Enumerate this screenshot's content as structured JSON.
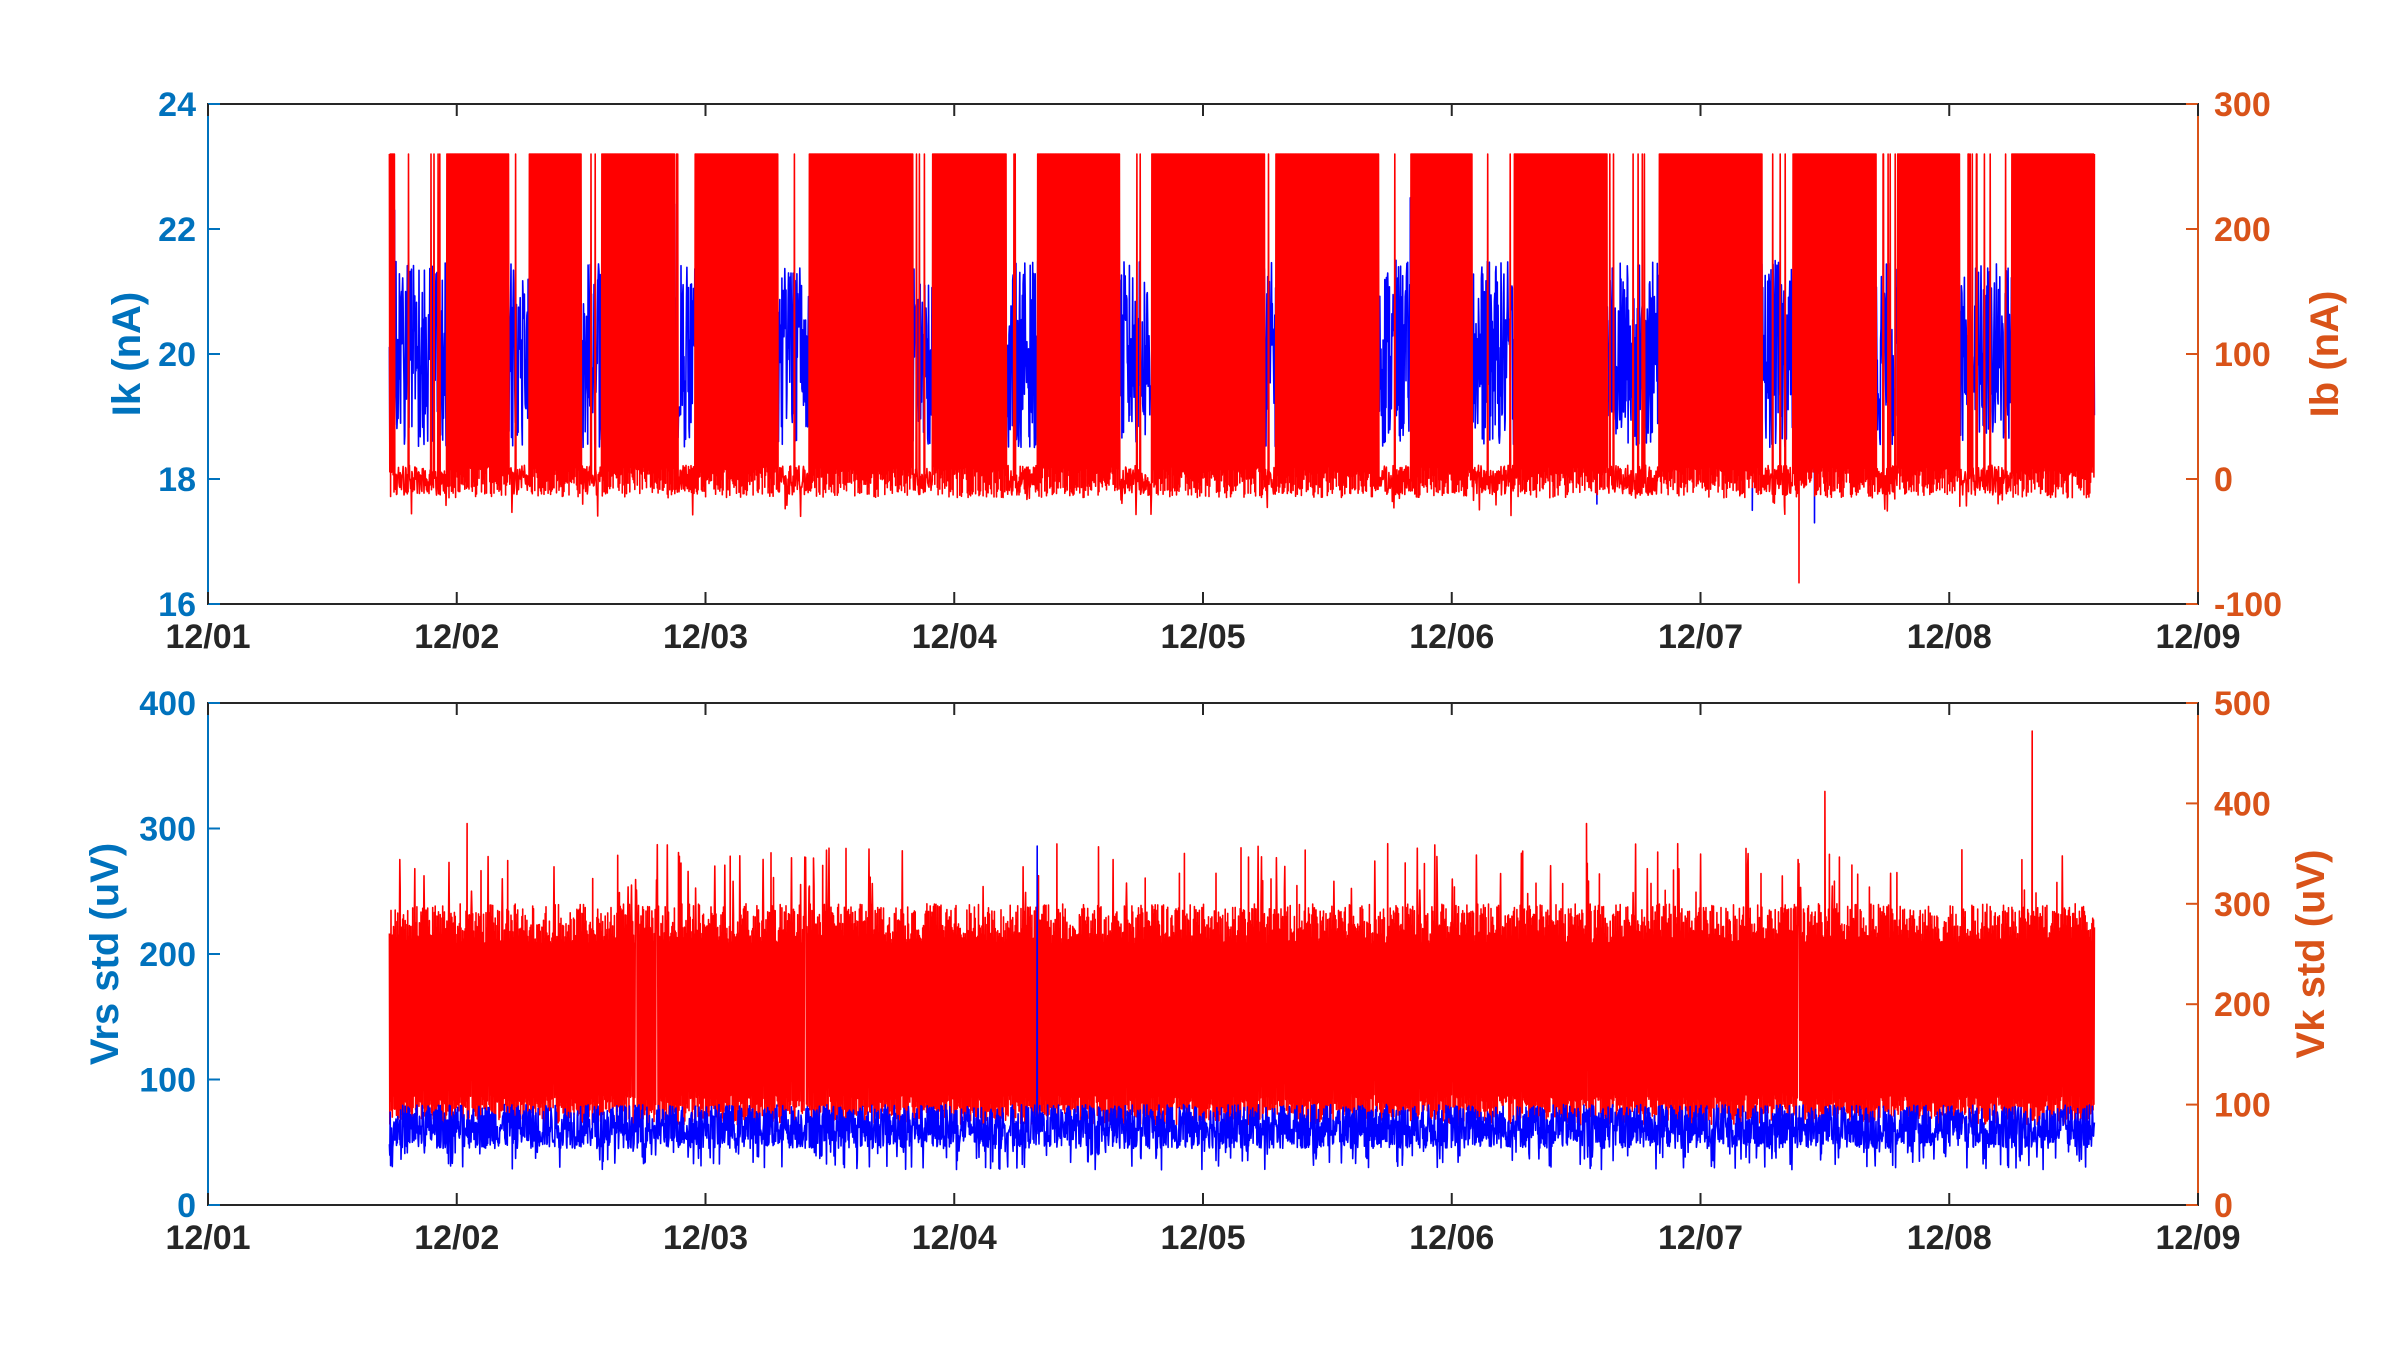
{
  "colors": {
    "left_axis": "#0072BD",
    "right_axis": "#D95319",
    "series_blue": "#0000FF",
    "series_red": "#FF0000",
    "tick_text_x": "#262626",
    "box": "#262626"
  },
  "chart_data": [
    {
      "type": "line",
      "xaxis": {
        "type": "date",
        "range": [
          "12/01",
          "12/09"
        ],
        "ticks": [
          "12/01",
          "12/02",
          "12/03",
          "12/04",
          "12/05",
          "12/06",
          "12/07",
          "12/08",
          "12/09"
        ]
      },
      "left_axis": {
        "label": "Ik (nA)",
        "ylim": [
          16,
          24
        ],
        "ticks": [
          "16",
          "18",
          "20",
          "22",
          "24"
        ]
      },
      "right_axis": {
        "label": "Ib (nA)",
        "ylim": [
          -100,
          300
        ],
        "ticks": [
          "-100",
          "0",
          "100",
          "200",
          "300"
        ]
      },
      "grid": false,
      "series": [
        {
          "axis": "left",
          "color": "blue",
          "x_start": "12/01 17:30",
          "x_end": "12/08 14:00",
          "typical_band": [
            18.5,
            21.5
          ],
          "peaks": [
            [
              "12/01 18:00",
              22.3
            ],
            [
              "12/02 21:00",
              22.4
            ],
            [
              "12/05 02:00",
              22.0
            ],
            [
              "12/05 20:00",
              22.5
            ],
            [
              "12/08 07:00",
              22.3
            ]
          ],
          "troughs": [
            [
              "12/06 14:00",
              17.6
            ],
            [
              "12/07 05:00",
              17.5
            ],
            [
              "12/07 11:00",
              17.3
            ]
          ]
        },
        {
          "axis": "right",
          "color": "red",
          "x_start": "12/01 17:30",
          "x_end": "12/08 14:00",
          "baseline": [
            -5,
            5
          ],
          "saturation_level": 260,
          "min_spike": [
            "12/07 09:30",
            -83
          ],
          "dense_intervals": [
            [
              "12/01 17:30",
              "12/01 18:00"
            ],
            [
              "12/01 23:00",
              "12/02 05:00"
            ],
            [
              "12/02 07:00",
              "12/02 12:00"
            ],
            [
              "12/02 14:00",
              "12/02 21:00"
            ],
            [
              "12/02 23:00",
              "12/03 07:00"
            ],
            [
              "12/03 10:00",
              "12/03 20:00"
            ],
            [
              "12/03 22:00",
              "12/04 05:00"
            ],
            [
              "12/04 08:00",
              "12/04 16:00"
            ],
            [
              "12/04 19:00",
              "12/05 06:00"
            ],
            [
              "12/05 07:00",
              "12/05 17:00"
            ],
            [
              "12/05 20:00",
              "12/06 02:00"
            ],
            [
              "12/06 06:00",
              "12/06 15:00"
            ],
            [
              "12/06 20:00",
              "12/07 06:00"
            ],
            [
              "12/07 09:00",
              "12/07 17:00"
            ],
            [
              "12/07 19:00",
              "12/08 01:00"
            ],
            [
              "12/08 06:00",
              "12/08 14:00"
            ]
          ]
        }
      ]
    },
    {
      "type": "line",
      "xaxis": {
        "type": "date",
        "range": [
          "12/01",
          "12/09"
        ],
        "ticks": [
          "12/01",
          "12/02",
          "12/03",
          "12/04",
          "12/05",
          "12/06",
          "12/07",
          "12/08",
          "12/09"
        ]
      },
      "left_axis": {
        "label": "Vrs std (uV)",
        "ylim": [
          0,
          400
        ],
        "ticks": [
          "0",
          "100",
          "200",
          "300",
          "400"
        ]
      },
      "right_axis": {
        "label": "Vk std (uV)",
        "ylim": [
          0,
          500
        ],
        "ticks": [
          "0",
          "100",
          "200",
          "300",
          "400",
          "500"
        ]
      },
      "grid": false,
      "series": [
        {
          "axis": "left",
          "color": "blue",
          "x_start": "12/01 17:30",
          "x_end": "12/08 14:00",
          "typical_band": [
            45,
            80
          ],
          "min_value": 28,
          "peak": [
            "12/04 08:00",
            286
          ]
        },
        {
          "axis": "right",
          "color": "red",
          "x_start": "12/01 17:30",
          "x_end": "12/08 14:00",
          "typical_band": [
            80,
            300
          ],
          "max_spike": [
            "12/08 08:00",
            472
          ],
          "other_spikes": [
            [
              "12/07 12:00",
              412
            ],
            [
              "12/02 01:00",
              380
            ],
            [
              "12/06 13:00",
              380
            ]
          ]
        }
      ]
    }
  ]
}
